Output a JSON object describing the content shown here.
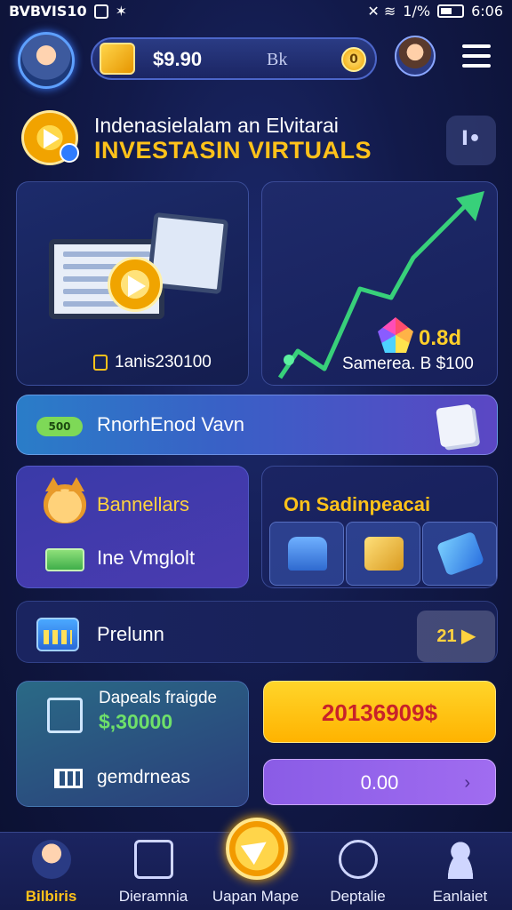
{
  "status_bar": {
    "left_text": "BVBVIS10",
    "time": "6:06",
    "battery_text": "1/%"
  },
  "top_bar": {
    "coin_amount": "$9.90",
    "coin_unit": "Bk",
    "gold_coin_glyph": "0"
  },
  "title": {
    "line1": "Indenasielalam an Elvitarai",
    "line2": "INVESTASIN VIRTUALS",
    "side_button": "I•"
  },
  "cards": {
    "reward_caption": "1anis230100",
    "growth_value": "0.8d",
    "growth_caption": "Samerea. B $100",
    "banner_pill": "500",
    "banner_label": "RnorhEnod Vavn",
    "pet_label": "Bannellars",
    "money_label": "Ine Vmglolt",
    "special_title": "On Sadinpeacai",
    "promo_label": "Prelunn",
    "promo_button": "21",
    "deposit_title": "Dapeals fraigde",
    "deposit_value": "$,30000",
    "grid_label": "gemdrneas",
    "gold_button": "20136909$",
    "purple_button": "0.00"
  },
  "nav": {
    "items": [
      {
        "label": "Bilbiris"
      },
      {
        "label": "Dieramnia"
      },
      {
        "label": "Uapan Mape"
      },
      {
        "label": "Deptalie"
      },
      {
        "label": "Eanlaiet"
      }
    ]
  },
  "colors": {
    "accent_gold": "#ffc21a",
    "accent_green": "#6ee06a",
    "background": "#121a4a"
  }
}
